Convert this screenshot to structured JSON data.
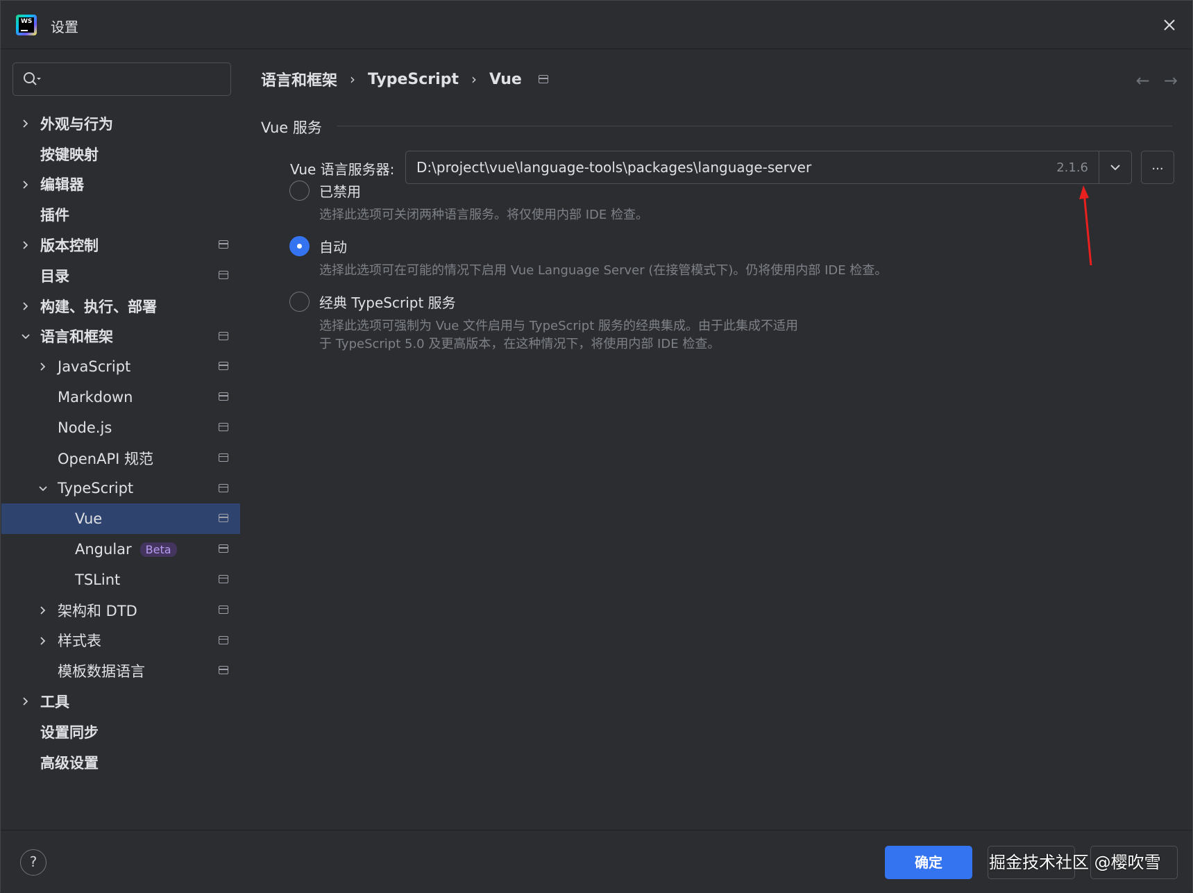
{
  "window": {
    "title": "设置",
    "logo_text": "WS"
  },
  "sidebar": {
    "search_placeholder": "",
    "items": [
      {
        "label": "外观与行为",
        "bold": true,
        "level": 0,
        "chevron": "right",
        "pin": false
      },
      {
        "label": "按键映射",
        "bold": true,
        "level": 0,
        "chevron": "none",
        "pin": false
      },
      {
        "label": "编辑器",
        "bold": true,
        "level": 0,
        "chevron": "right",
        "pin": false
      },
      {
        "label": "插件",
        "bold": true,
        "level": 0,
        "chevron": "none",
        "pin": false
      },
      {
        "label": "版本控制",
        "bold": true,
        "level": 0,
        "chevron": "right",
        "pin": true
      },
      {
        "label": "目录",
        "bold": true,
        "level": 0,
        "chevron": "none",
        "pin": true
      },
      {
        "label": "构建、执行、部署",
        "bold": true,
        "level": 0,
        "chevron": "right",
        "pin": false
      },
      {
        "label": "语言和框架",
        "bold": true,
        "level": 0,
        "chevron": "down",
        "pin": true
      },
      {
        "label": "JavaScript",
        "bold": false,
        "level": 1,
        "chevron": "right",
        "pin": true
      },
      {
        "label": "Markdown",
        "bold": false,
        "level": 1,
        "chevron": "none",
        "pin": true
      },
      {
        "label": "Node.js",
        "bold": false,
        "level": 1,
        "chevron": "none",
        "pin": true
      },
      {
        "label": "OpenAPI 规范",
        "bold": false,
        "level": 1,
        "chevron": "none",
        "pin": true
      },
      {
        "label": "TypeScript",
        "bold": false,
        "level": 1,
        "chevron": "down",
        "pin": true
      },
      {
        "label": "Vue",
        "bold": false,
        "level": 2,
        "chevron": "none",
        "pin": true,
        "selected": true
      },
      {
        "label": "Angular",
        "bold": false,
        "level": 2,
        "chevron": "none",
        "pin": true,
        "badge": "Beta"
      },
      {
        "label": "TSLint",
        "bold": false,
        "level": 2,
        "chevron": "none",
        "pin": true
      },
      {
        "label": "架构和 DTD",
        "bold": false,
        "level": 1,
        "chevron": "right",
        "pin": true
      },
      {
        "label": "样式表",
        "bold": false,
        "level": 1,
        "chevron": "right",
        "pin": true
      },
      {
        "label": "模板数据语言",
        "bold": false,
        "level": 1,
        "chevron": "none",
        "pin": true
      },
      {
        "label": "工具",
        "bold": true,
        "level": 0,
        "chevron": "right",
        "pin": false
      },
      {
        "label": "设置同步",
        "bold": true,
        "level": 0,
        "chevron": "none",
        "pin": false
      },
      {
        "label": "高级设置",
        "bold": true,
        "level": 0,
        "chevron": "none",
        "pin": false
      }
    ]
  },
  "main": {
    "breadcrumb": [
      "语言和框架",
      "TypeScript",
      "Vue"
    ],
    "breadcrumb_sep": "›",
    "back_arrow": "←",
    "forward_arrow": "→",
    "section_title": "Vue 服务",
    "server_label": "Vue 语言服务器:",
    "server_path": "D:\\project\\vue\\language-tools\\packages\\language-server",
    "server_version": "2.1.6",
    "more_button": "...",
    "options": [
      {
        "label": "已禁用",
        "checked": false,
        "desc": [
          "选择此选项可关闭两种语言服务。将仅使用内部 IDE 检查。"
        ]
      },
      {
        "label": "自动",
        "checked": true,
        "desc": [
          "选择此选项可在可能的情况下启用 Vue Language Server (在接管模式下)。仍将使用内部 IDE 检查。"
        ]
      },
      {
        "label": "经典 TypeScript 服务",
        "checked": false,
        "desc": [
          "选择此选项可强制为 Vue 文件启用与 TypeScript 服务的经典集成。由于此集成不适用",
          "于 TypeScript 5.0 及更高版本，在这种情况下，将使用内部 IDE 检查。"
        ]
      }
    ]
  },
  "footer": {
    "help": "?",
    "ok": "确定",
    "watermark": "掘金技术社区 @樱吹雪"
  },
  "colors": {
    "background": "#2b2d30",
    "accent": "#3574f0",
    "selected_row": "#2e436e",
    "annotation_arrow": "#e8201f"
  }
}
